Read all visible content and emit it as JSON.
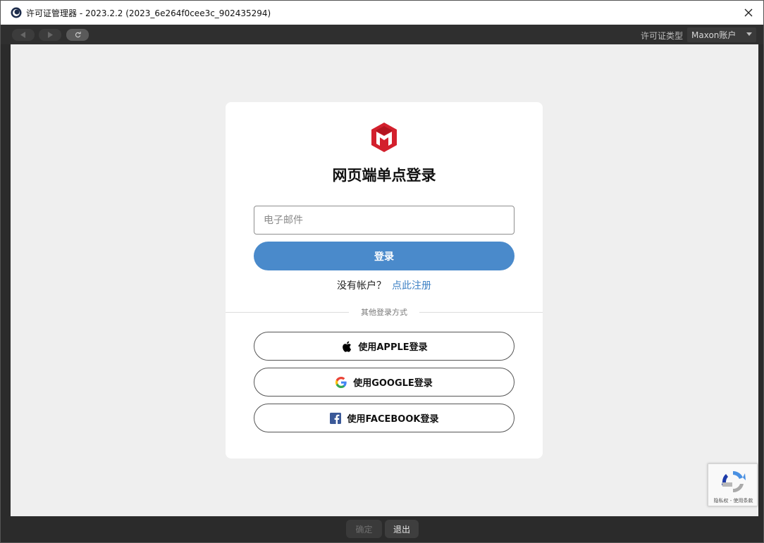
{
  "window": {
    "title": "许可证管理器 - 2023.2.2 (2023_6e264f0cee3c_902435294)"
  },
  "toolbar": {
    "license_type_label": "许可证类型",
    "license_type_value": "Maxon账户"
  },
  "login": {
    "title": "网页端单点登录",
    "email_placeholder": "电子邮件",
    "login_button": "登录",
    "no_account_text": "没有帐户？",
    "signup_link": "点此注册",
    "other_methods": "其他登录方式",
    "apple_button": "使用APPLE登录",
    "google_button": "使用GOOGLE登录",
    "facebook_button": "使用FACEBOOK登录"
  },
  "recaptcha": {
    "text": "隐私权 - 使用条款"
  },
  "footer": {
    "ok_button": "确定",
    "exit_button": "退出"
  },
  "colors": {
    "login_button": "#4a8acb",
    "signup_link": "#3d80c4",
    "brand_red": "#d3202d",
    "facebook_blue": "#3b5998"
  }
}
